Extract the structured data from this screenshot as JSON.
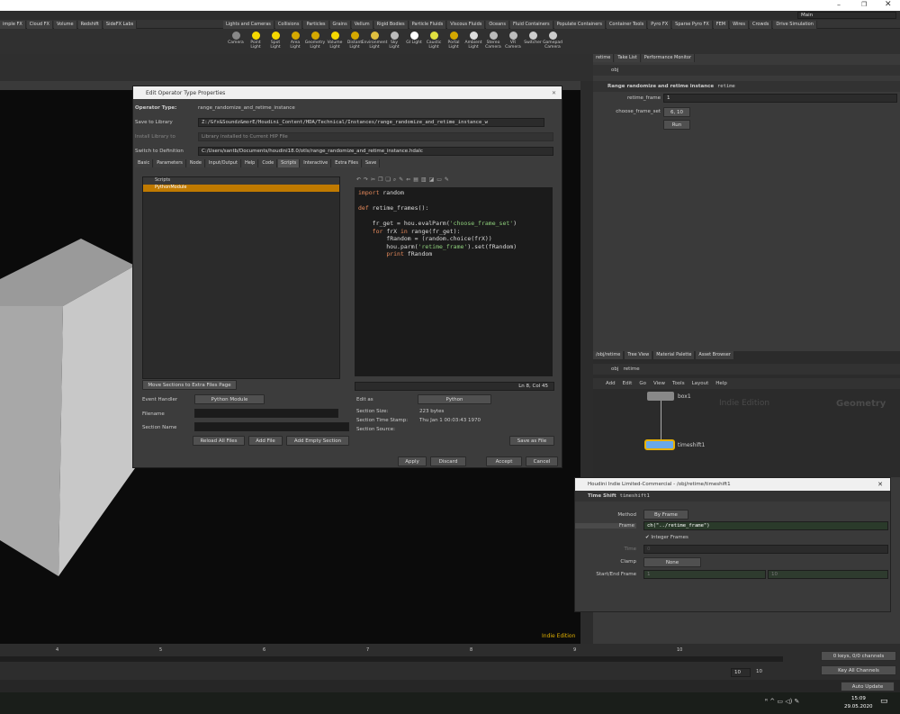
{
  "window": {
    "desktop": "Main"
  },
  "shelf_tabs_left": [
    "imple FX",
    "Cloud FX",
    "Volume",
    "Redshift",
    "SideFX Labs"
  ],
  "shelf_tabs_right": [
    "Lights and Cameras",
    "Collisions",
    "Particles",
    "Grains",
    "Vellum",
    "Rigid Bodies",
    "Particle Fluids",
    "Viscous Fluids",
    "Oceans",
    "Fluid Containers",
    "Populate Containers",
    "Container Tools",
    "Pyro FX",
    "Sparse Pyro FX",
    "FEM",
    "Wires",
    "Crowds",
    "Drive Simulation"
  ],
  "shelf_tools": [
    "Camera",
    "Point Light",
    "Spot Light",
    "Area Light",
    "Geometry Light",
    "Volume Light",
    "Distant Light",
    "Environment Light",
    "Sky Light",
    "GI Light",
    "Caustic Light",
    "Portal Light",
    "Ambient Light",
    "Stereo Camera",
    "VR Camera",
    "Switcher",
    "Gamepad Camera"
  ],
  "dialog": {
    "title": "Edit Operator Type Properties",
    "operator_type_label": "Operator Type:",
    "operator_type": "range_randomize_and_retime_instance",
    "save_to_library_label": "Save to Library",
    "save_to_library": "Z:/Gfx&Soundz&morE/Houdini_Content/HDA/Technical/Instances/range_randomize_and_retime_instance_w",
    "install_label": "Install Library to",
    "install": "Library installed to Current HIP File",
    "switch_label": "Switch to Definition",
    "switch": "C:/Users/santb/Documents/houdini18.0/otls/range_randomize_and_retime_instance.hdalc",
    "tabs": [
      "Basic",
      "Parameters",
      "Node",
      "Input/Output",
      "Help",
      "Code",
      "Scripts",
      "Interactive",
      "Extra Files",
      "Save"
    ],
    "scripts_header": "Scripts",
    "scripts_item": "PythonModule",
    "code_lines": [
      "import random",
      "",
      "def retime_frames():",
      "",
      "    fr_get = hou.evalParm('choose_frame_set')",
      "    for frX in range(fr_get):",
      "        fRandom = (random.choice(frX))",
      "        hou.parm('retime_frame').set(fRandom)",
      "        print fRandom"
    ],
    "cursor": "Ln 8, Col 45",
    "move_btn": "Move Sections to Extra Files Page",
    "event_handler_label": "Event Handler",
    "event_handler": "Python Module",
    "filename_label": "Filename",
    "section_name_label": "Section Name",
    "reload_btn": "Reload All Files",
    "add_file_btn": "Add File",
    "add_empty_btn": "Add Empty Section",
    "edit_as_label": "Edit as",
    "edit_as": "Python",
    "section_size_label": "Section Size:",
    "section_size": "223 bytes",
    "timestamp_label": "Section Time Stamp:",
    "timestamp": "Thu Jan 1 00:03:43 1970",
    "source_label": "Section Source:",
    "save_as_file_btn": "Save as File",
    "apply": "Apply",
    "discard": "Discard",
    "accept": "Accept",
    "cancel": "Cancel"
  },
  "param_pane": {
    "tabs": [
      "retime",
      "Take List",
      "Performance Monitor"
    ],
    "path": "obj",
    "title": "Range randomize and retime instance",
    "node": "retime",
    "retime_frame_label": "retime_frame",
    "retime_frame": "1",
    "choose_frame_set_label": "choose_frame_set",
    "choose_frame_set": "6, 10",
    "run": "Run"
  },
  "network": {
    "tabs": [
      "/obj/retime",
      "Tree View",
      "Material Palette",
      "Asset Browser"
    ],
    "path_obj": "obj",
    "path_node": "retime",
    "menu": [
      "Add",
      "Edit",
      "Go",
      "View",
      "Tools",
      "Layout",
      "Help"
    ],
    "watermark": "Indie Edition",
    "context": "Geometry",
    "node1": "box1",
    "node2": "timeshift1"
  },
  "float_win": {
    "title": "Houdini Indie Limited-Commercial - /obj/retime/timeshift1",
    "type": "Time Shift",
    "name": "timeshift1",
    "method_label": "Method",
    "method": "By Frame",
    "frame_label": "Frame",
    "frame": "ch(\"../retime_frame\")",
    "integer_label": "Integer Frames",
    "time_label": "Time",
    "time": "0",
    "clamp_label": "Clamp",
    "clamp": "None",
    "startend_label": "Start/End Frame",
    "start": "1",
    "end": "10"
  },
  "viewport": {
    "watermark": "Indie Edition"
  },
  "timeline": {
    "ticks": [
      "4",
      "5",
      "6",
      "7",
      "8",
      "9",
      "10"
    ],
    "frame": "10",
    "end": "10",
    "keys": "0 keys, 0/0 channels",
    "key_all": "Key All Channels",
    "auto_update": "Auto Update"
  },
  "taskbar": {
    "time": "15:09",
    "date": "29.05.2020"
  }
}
